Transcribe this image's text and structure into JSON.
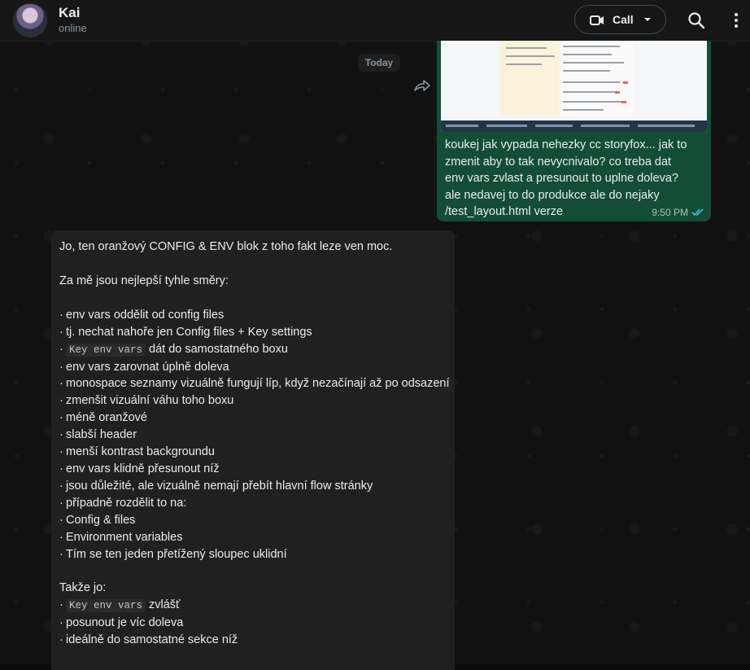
{
  "header": {
    "contact_name": "Kai",
    "status": "online",
    "call_label": "Call"
  },
  "chat": {
    "date_label": "Today",
    "outgoing": {
      "text": "koukej jak vypada nehezky cc storyfox... jak to zmenit aby to tak nevycnivalo? co treba dat env vars zvlast a presunout to uplne doleva? ale nedavej to do produkce ale do nejaky /test_layout.html verze",
      "time": "9:50 PM"
    },
    "incoming": {
      "intro": "Jo, ten oranžový CONFIG & ENV blok z toho fakt leze ven moc.",
      "subhead": "Za mě jsou nejlepší tyhle směry:",
      "bullets": [
        "env vars oddělit od config files",
        "tj. nechat nahoře jen Config files + Key settings",
        {
          "code": "Key env vars",
          "text": "dát do samostatného boxu"
        },
        "env vars zarovnat úplně doleva",
        "monospace seznamy vizuálně fungují líp, když nezačínají až po odsazení",
        "zmenšit vizuální váhu toho boxu",
        "méně oranžové",
        "slabší header",
        "menší kontrast backgroundu",
        "env vars klidně přesunout níž",
        "jsou důležité, ale vizuálně nemají přebít hlavní flow stránky",
        "případně rozdělit to na:",
        "Config & files",
        "Environment variables",
        "Tím se ten jeden přetížený sloupec uklidní"
      ],
      "conclusion": "Takže jo:",
      "final_bullets": [
        {
          "code": "Key env vars",
          "text": "zvlášť"
        },
        "posunout je víc doleva",
        "ideálně do samostatné sekce níž"
      ]
    }
  },
  "colors": {
    "outgoing_bubble": "#144d37",
    "incoming_bubble": "#202020",
    "read_ticks": "#53bdeb"
  }
}
